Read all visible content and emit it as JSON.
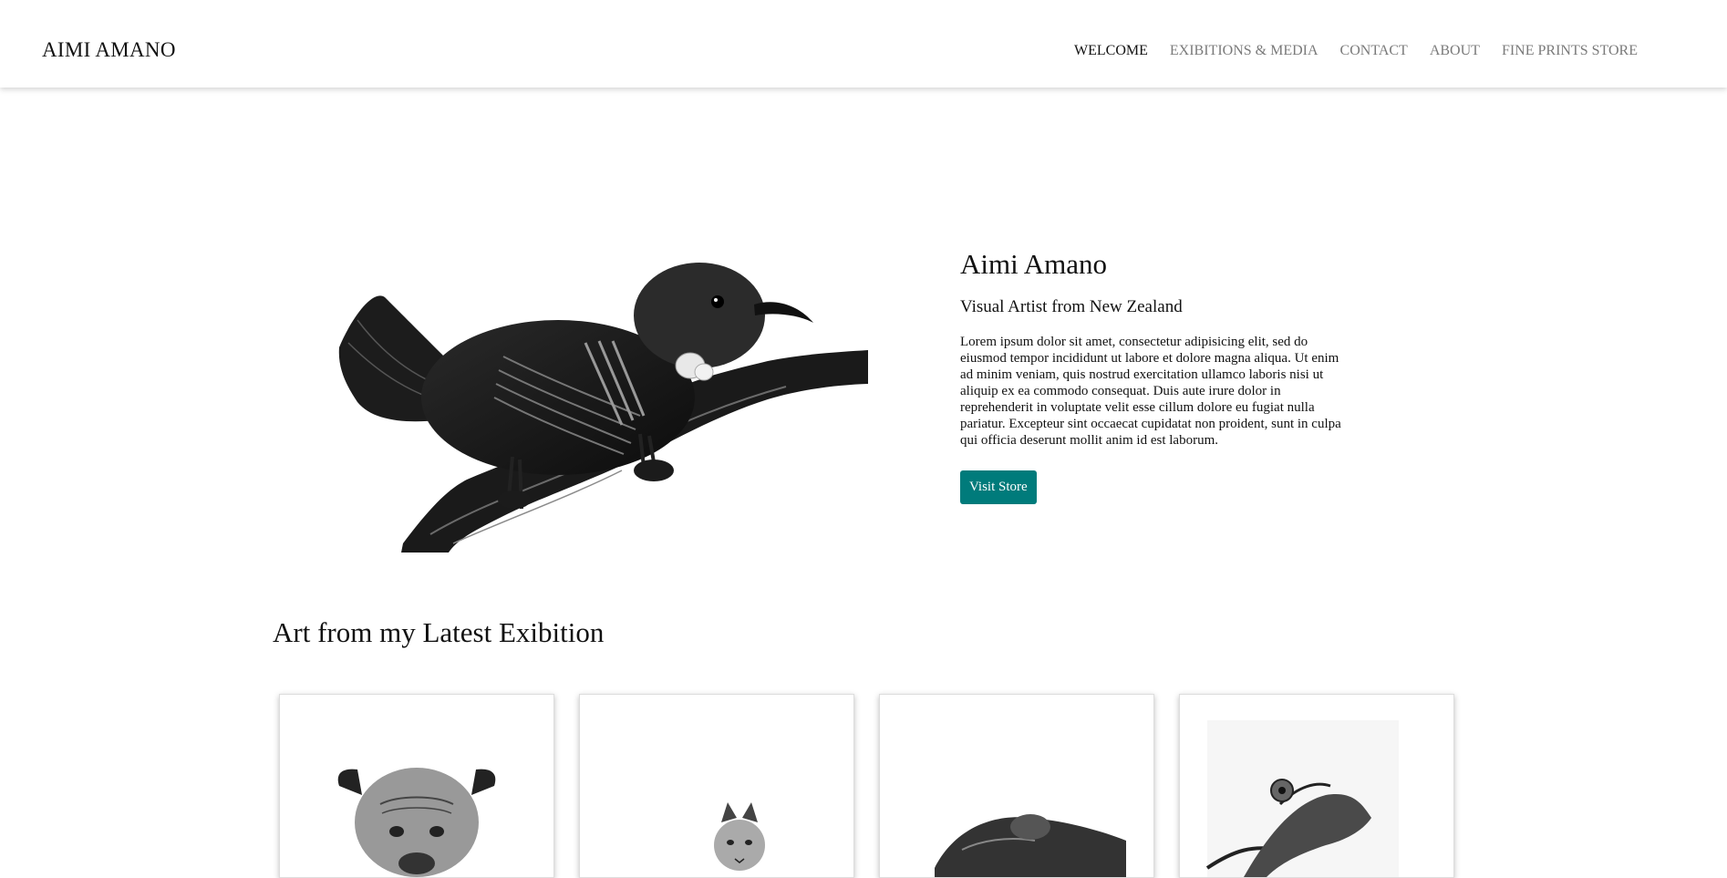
{
  "header": {
    "brand": "AIMI AMANO",
    "nav": [
      {
        "label": "WELCOME",
        "active": true
      },
      {
        "label": "EXIBITIONS & MEDIA",
        "active": false
      },
      {
        "label": "CONTACT",
        "active": false
      },
      {
        "label": "ABOUT",
        "active": false
      },
      {
        "label": "FINE PRINTS STORE",
        "active": false
      }
    ]
  },
  "hero": {
    "image_icon": "tui-bird-illustration",
    "title": "Aimi Amano",
    "subtitle": "Visual Artist from New Zealand",
    "body": "Lorem ipsum dolor sit amet, consectetur adipisicing elit, sed do eiusmod tempor incididunt ut labore et dolore magna aliqua. Ut enim ad minim veniam, quis nostrud exercitation ullamco laboris nisi ut aliquip ex ea commodo consequat. Duis aute irure dolor in reprehenderit in voluptate velit esse cillum dolore eu fugiat nulla pariatur. Excepteur sint occaecat cupidatat non proident, sunt in culpa qui officia deserunt mollit anim id est laborum.",
    "button_label": "Visit Store"
  },
  "exhibition": {
    "title": "Art from my Latest Exibition",
    "cards": [
      {
        "icon": "dog-drawing"
      },
      {
        "icon": "cat-drawing"
      },
      {
        "icon": "lizard-drawing"
      },
      {
        "icon": "chameleon-drawing"
      }
    ]
  },
  "colors": {
    "accent": "#007b7b",
    "nav_inactive": "#7a7a7a",
    "text": "#111111"
  }
}
